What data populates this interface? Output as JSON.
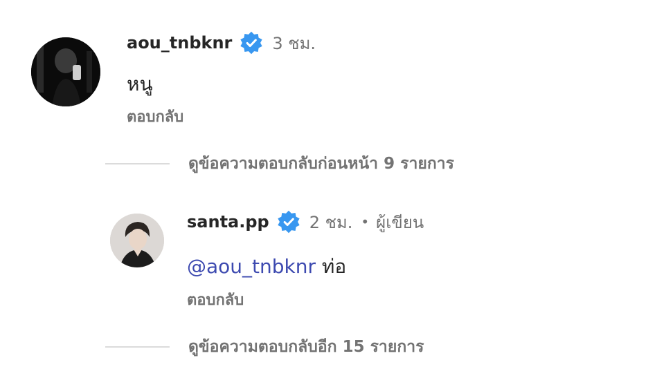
{
  "colors": {
    "verified": "#3897f0",
    "mention": "#3d4ab0",
    "muted": "#737373",
    "divider": "#dbdbdb"
  },
  "comment": {
    "username": "aou_tnbknr",
    "time": "3 ชม.",
    "text": "หนู",
    "reply_label": "ตอบกลับ",
    "view_previous_replies": "ดูข้อความตอบกลับก่อนหน้า 9 รายการ"
  },
  "reply_comment": {
    "username": "santa.pp",
    "time": "2 ชม.",
    "separator": "•",
    "author_badge": "ผู้เขียน",
    "mention": "@aou_tnbknr",
    "text": "ท่อ",
    "reply_label": "ตอบกลับ",
    "view_more_replies": "ดูข้อความตอบกลับอีก 15 รายการ"
  },
  "icons": {
    "verified": "verified-badge-icon"
  }
}
